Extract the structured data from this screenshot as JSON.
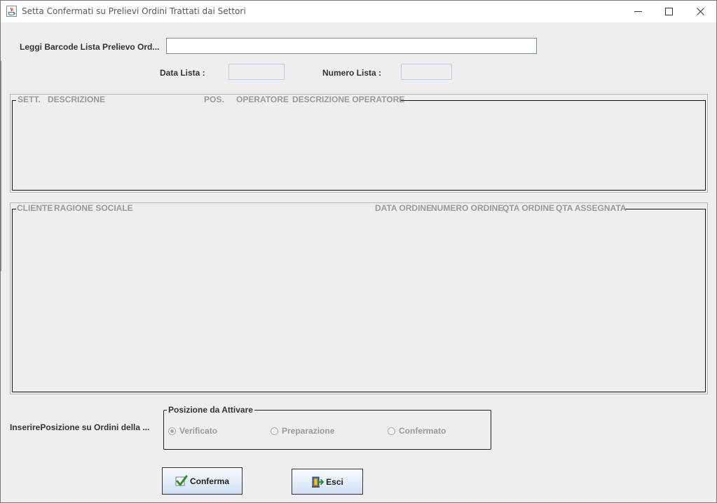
{
  "window": {
    "title": "Setta Confermati su Prelievi Ordini Trattati dai Settori",
    "controls": [
      "minimize",
      "maximize",
      "close"
    ]
  },
  "barcode": {
    "label": "Leggi Barcode Lista Prelievo Ord...",
    "value": "",
    "placeholder": ""
  },
  "list_info": {
    "data_label": "Data Lista :",
    "data_value": "",
    "numero_label": "Numero Lista :",
    "numero_value": ""
  },
  "settori_table": {
    "columns": [
      "SETT.",
      "DESCRIZIONE",
      "POS.",
      "OPERATORE",
      "DESCRIZIONE OPERATORE"
    ],
    "rows": []
  },
  "ordini_table": {
    "columns": [
      "CLIENTE",
      "RAGIONE SOCIALE",
      "DATA ORDINE",
      "NUMERO ORDINE",
      "QTA ORDINE",
      "QTA ASSEGNATA"
    ],
    "rows": []
  },
  "posizione": {
    "prompt_label": "InserirePosizione su Ordini della ...",
    "group_title": "Posizione da Attivare",
    "options": [
      {
        "label": "Verificato",
        "selected": true
      },
      {
        "label": "Preparazione",
        "selected": false
      },
      {
        "label": "Confermato",
        "selected": false
      }
    ]
  },
  "buttons": {
    "conferma": "Conferma",
    "esci": "Esci"
  },
  "colors": {
    "background": "#eeeeee",
    "disabled_text": "#999999",
    "button_gradient_top": "#f7fbff",
    "button_gradient_bottom": "#cfdff3",
    "disabled_field_border": "#b8cfe5"
  },
  "icons": {
    "app": "java-app-icon",
    "conferma": "checkmark-icon",
    "esci": "exit-door-icon"
  }
}
